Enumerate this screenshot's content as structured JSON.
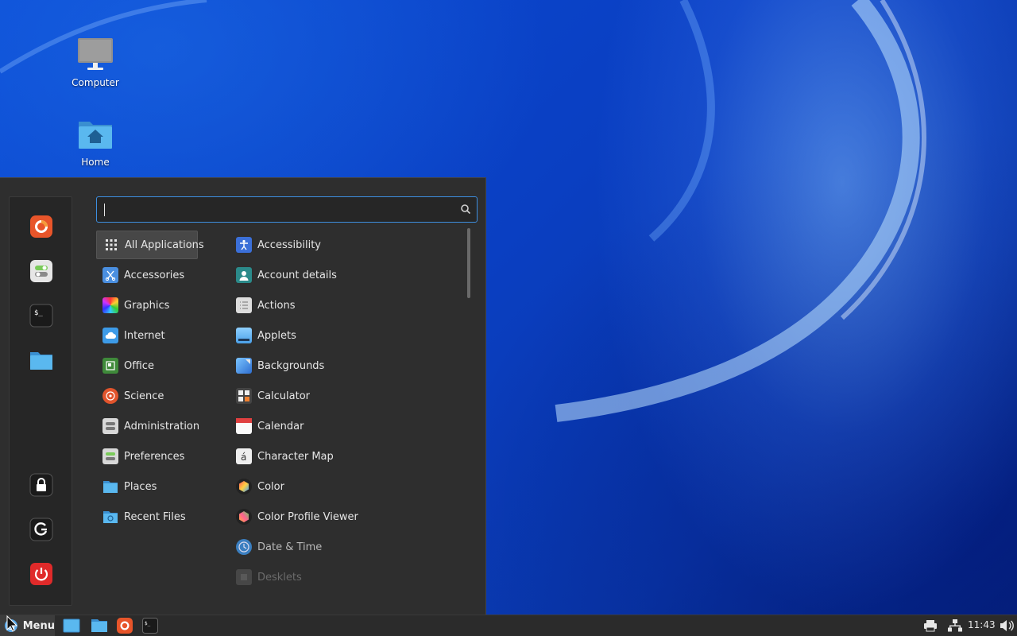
{
  "desktop": {
    "icons": [
      {
        "label": "Computer",
        "icon": "computer-icon"
      },
      {
        "label": "Home",
        "icon": "home-folder-icon"
      }
    ]
  },
  "menu": {
    "search": {
      "value": "",
      "placeholder": ""
    },
    "favorites": [
      {
        "name": "Firefox",
        "icon": "firefox-icon"
      },
      {
        "name": "Settings",
        "icon": "settings-toggle-icon"
      },
      {
        "name": "Terminal",
        "icon": "terminal-icon"
      },
      {
        "name": "Files",
        "icon": "folder-icon"
      }
    ],
    "session": [
      {
        "name": "Lock Screen",
        "icon": "lock-icon"
      },
      {
        "name": "Logout",
        "icon": "logout-icon"
      },
      {
        "name": "Quit",
        "icon": "power-icon"
      }
    ],
    "categories": [
      {
        "label": "All Applications",
        "icon": "grid-icon",
        "color": "#444444"
      },
      {
        "label": "Accessories",
        "icon": "scissors-icon",
        "color": "#4a8fe0"
      },
      {
        "label": "Graphics",
        "icon": "graphics-icon",
        "color": "#b040d0"
      },
      {
        "label": "Internet",
        "icon": "cloud-icon",
        "color": "#3d9be8"
      },
      {
        "label": "Office",
        "icon": "office-icon",
        "color": "#3f8a3a"
      },
      {
        "label": "Science",
        "icon": "atom-icon",
        "color": "#e2542c"
      },
      {
        "label": "Administration",
        "icon": "admin-icon",
        "color": "#d8d8d8"
      },
      {
        "label": "Preferences",
        "icon": "preferences-icon",
        "color": "#d8d8d8"
      },
      {
        "label": "Places",
        "icon": "folder-icon",
        "color": "#4fb0e8"
      },
      {
        "label": "Recent Files",
        "icon": "recent-folder-icon",
        "color": "#4fb0e8"
      }
    ],
    "apps": [
      {
        "label": "Accessibility",
        "icon": "accessibility-icon",
        "color": "#3b6fd8"
      },
      {
        "label": "Account details",
        "icon": "account-icon",
        "color": "#2b8a8a"
      },
      {
        "label": "Actions",
        "icon": "actions-icon",
        "color": "#dddddd"
      },
      {
        "label": "Applets",
        "icon": "applets-icon",
        "color": "#5aaee8"
      },
      {
        "label": "Backgrounds",
        "icon": "backgrounds-icon",
        "color": "#4a90e0"
      },
      {
        "label": "Calculator",
        "icon": "calculator-icon",
        "color": "#444444"
      },
      {
        "label": "Calendar",
        "icon": "calendar-icon",
        "color": "#e04040"
      },
      {
        "label": "Character Map",
        "icon": "charmap-icon",
        "color": "#eeeeee"
      },
      {
        "label": "Color",
        "icon": "color-icon",
        "color": "#222222"
      },
      {
        "label": "Color Profile Viewer",
        "icon": "color-profile-icon",
        "color": "#222222"
      },
      {
        "label": "Date & Time",
        "icon": "clock-icon",
        "color": "#3b7fc0"
      },
      {
        "label": "Desklets",
        "icon": "desklets-icon",
        "color": "#777777"
      }
    ]
  },
  "taskbar": {
    "menu_label": "Menu",
    "launchers": [
      {
        "name": "Show Desktop",
        "icon": "show-desktop-icon"
      },
      {
        "name": "Files",
        "icon": "folder-icon"
      },
      {
        "name": "Firefox",
        "icon": "firefox-icon"
      },
      {
        "name": "Terminal",
        "icon": "terminal-icon"
      }
    ],
    "tray": {
      "printer": "printer-icon",
      "network": "network-icon",
      "volume": "volume-icon"
    },
    "clock": "11:43"
  }
}
